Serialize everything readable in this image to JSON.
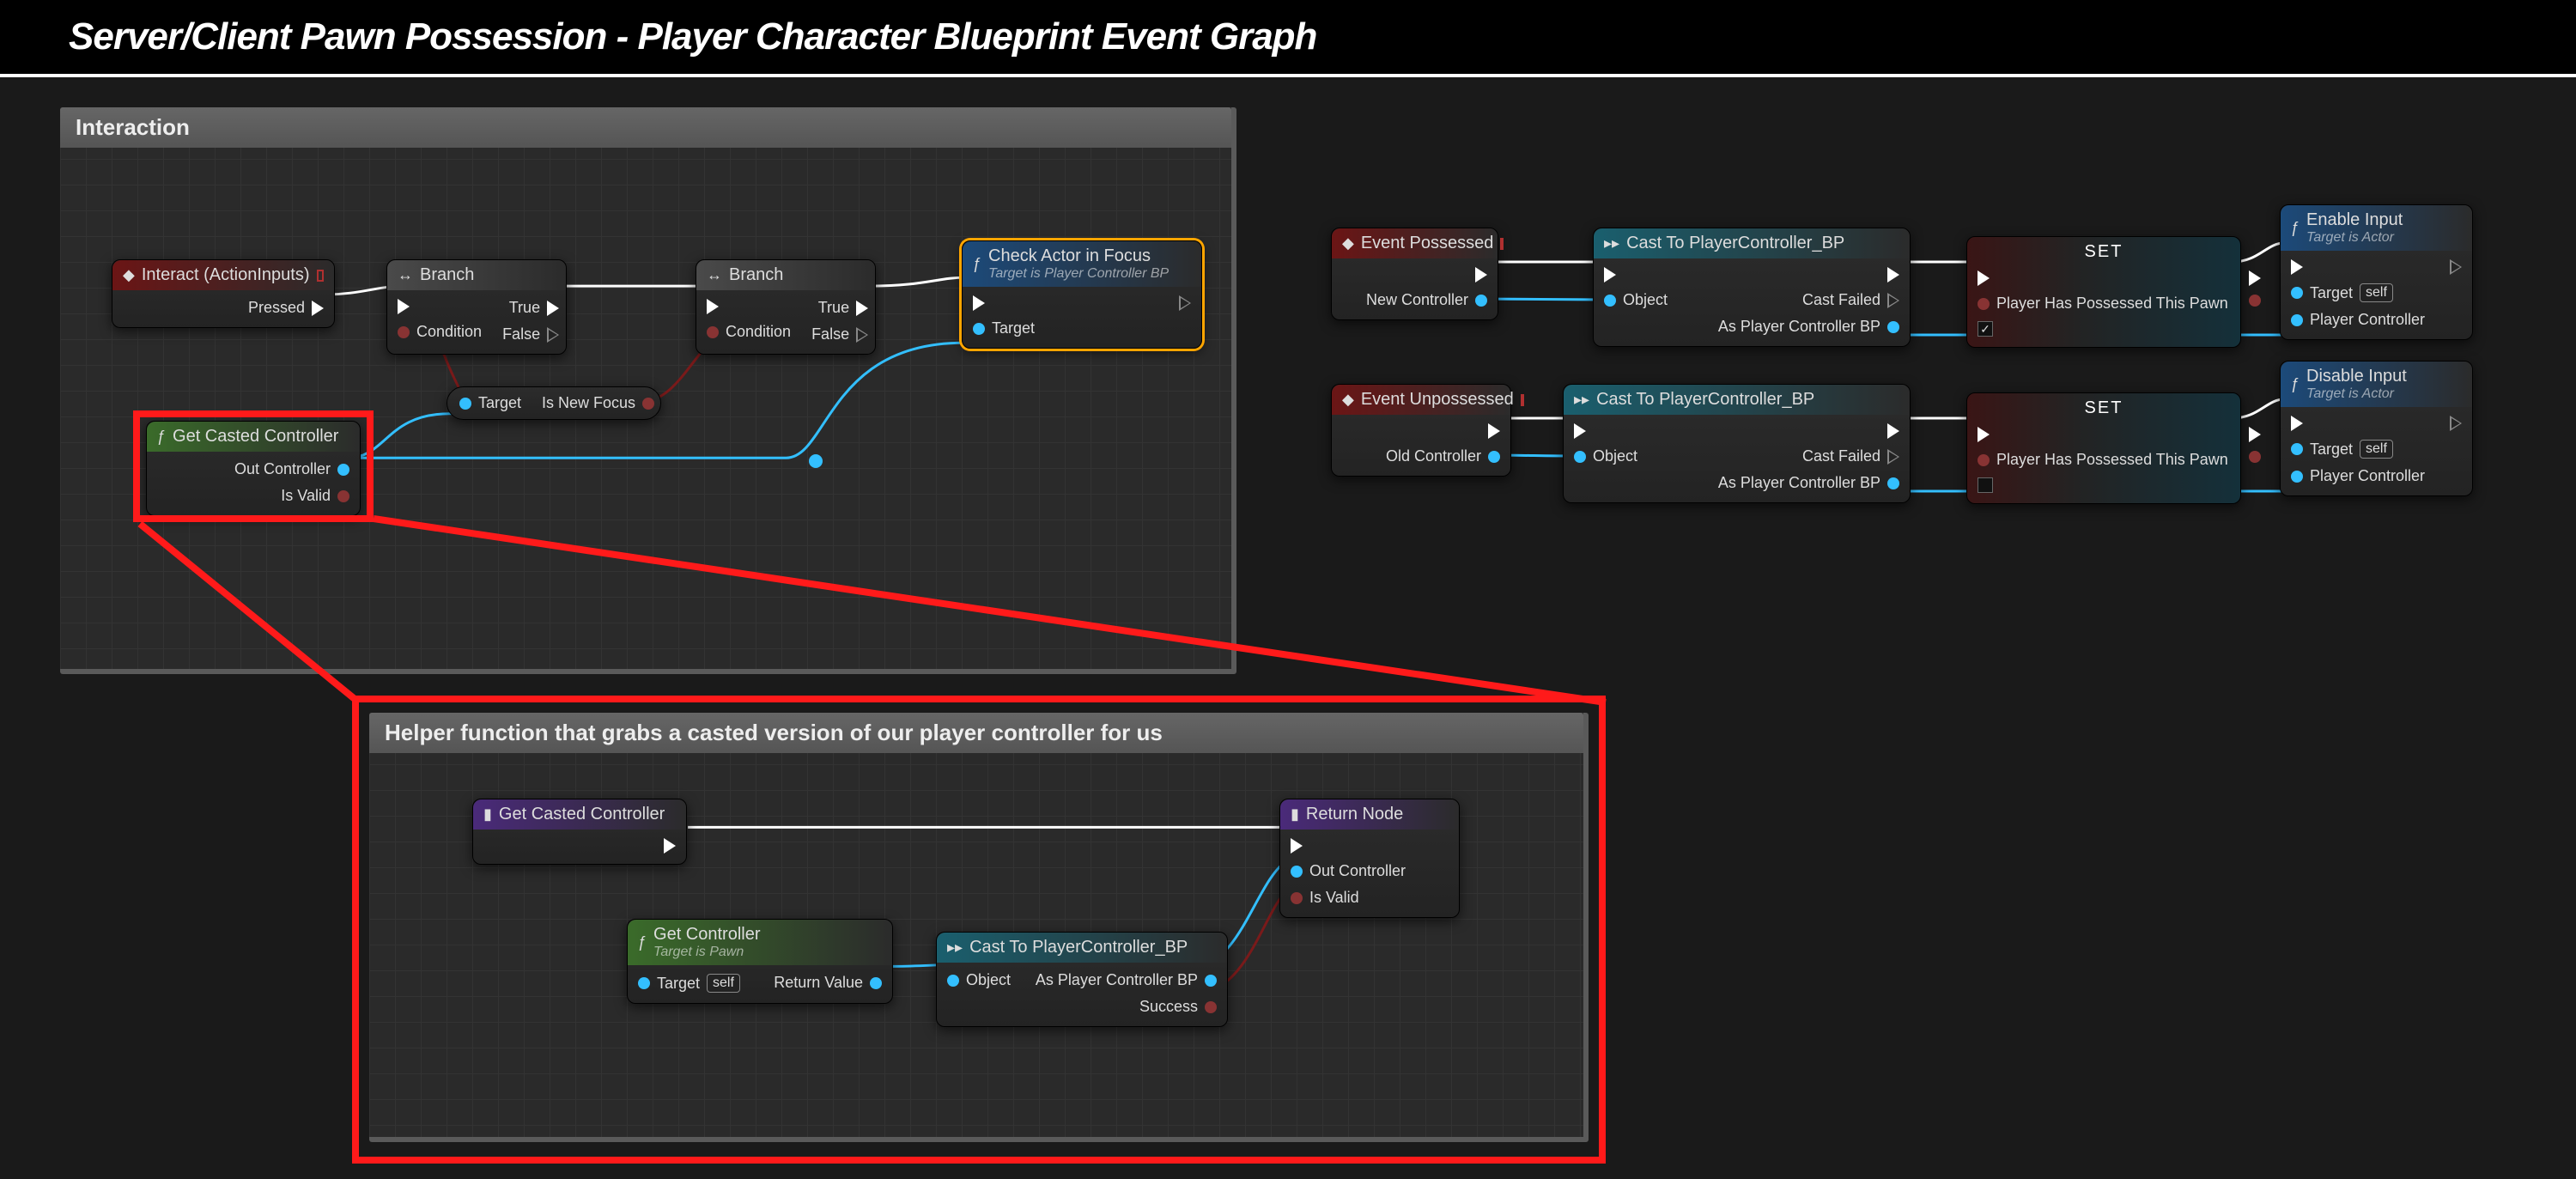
{
  "page": {
    "title": "Server/Client Pawn Possession - Player Character Blueprint Event Graph"
  },
  "panels": {
    "interaction": {
      "title": "Interaction"
    },
    "helper": {
      "title": "Helper function that grabs a casted version of our player controller for us"
    }
  },
  "nodes": {
    "interact": {
      "title": "Interact (ActionInputs)",
      "out_exec": "Pressed"
    },
    "branch1": {
      "title": "Branch",
      "in_cond": "Condition",
      "out_true": "True",
      "out_false": "False"
    },
    "branch2": {
      "title": "Branch",
      "in_cond": "Condition",
      "out_true": "True",
      "out_false": "False"
    },
    "checkActor": {
      "title": "Check Actor in Focus",
      "sub": "Target is Player Controller BP",
      "in_target": "Target"
    },
    "getCasted": {
      "title": "Get Casted Controller",
      "out_ctrl": "Out Controller",
      "out_valid": "Is Valid"
    },
    "focusGetter": {
      "in_target": "Target",
      "out_val": "Is New Focus"
    },
    "evtPossessed": {
      "title": "Event Possessed",
      "out_pin": "New Controller"
    },
    "evtUnpossessed": {
      "title": "Event Unpossessed",
      "out_pin": "Old Controller"
    },
    "cast1": {
      "title": "Cast To PlayerController_BP",
      "in_obj": "Object",
      "out_fail": "Cast Failed",
      "out_as": "As Player Controller BP"
    },
    "cast2": {
      "title": "Cast To PlayerController_BP",
      "in_obj": "Object",
      "out_fail": "Cast Failed",
      "out_as": "As Player Controller BP"
    },
    "set1": {
      "title": "SET",
      "var": "Player Has Possessed This Pawn",
      "checked": true
    },
    "set2": {
      "title": "SET",
      "var": "Player Has Possessed This Pawn",
      "checked": false
    },
    "enableInput": {
      "title": "Enable Input",
      "sub": "Target is Actor",
      "in_target": "Target",
      "in_pc": "Player Controller",
      "self": "self"
    },
    "disableInput": {
      "title": "Disable Input",
      "sub": "Target is Actor",
      "in_target": "Target",
      "in_pc": "Player Controller",
      "self": "self"
    },
    "helperEntry": {
      "title": "Get Casted Controller"
    },
    "getController": {
      "title": "Get Controller",
      "sub": "Target is Pawn",
      "in_target": "Target",
      "out_rv": "Return Value",
      "self": "self"
    },
    "castHelper": {
      "title": "Cast To PlayerController_BP",
      "in_obj": "Object",
      "out_as": "As Player Controller BP",
      "out_succ": "Success"
    },
    "returnNode": {
      "title": "Return Node",
      "in_ctrl": "Out Controller",
      "in_valid": "Is Valid"
    }
  }
}
